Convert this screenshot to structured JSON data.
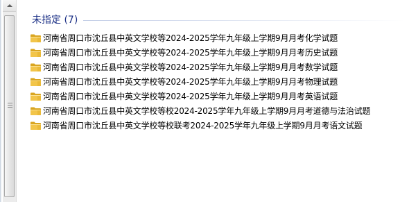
{
  "group": {
    "title": "未指定 (7)",
    "items": [
      {
        "name": "河南省周口市沈丘县中英文学校等2024-2025学年九年级上学期9月月考化学试题",
        "icon": "folder-icon"
      },
      {
        "name": "河南省周口市沈丘县中英文学校等2024-2025学年九年级上学期9月月考历史试题",
        "icon": "folder-icon"
      },
      {
        "name": "河南省周口市沈丘县中英文学校等2024-2025学年九年级上学期9月月考数学试题",
        "icon": "folder-icon"
      },
      {
        "name": "河南省周口市沈丘县中英文学校等2024-2025学年九年级上学期9月月考物理试题",
        "icon": "folder-icon"
      },
      {
        "name": "河南省周口市沈丘县中英文学校等2024-2025学年九年级上学期9月月考英语试题",
        "icon": "folder-icon"
      },
      {
        "name": "河南省周口市沈丘县中英文学校等校2024-2025学年九年级上学期9月月考道德与法治试题",
        "icon": "folder-icon"
      },
      {
        "name": "河南省周口市沈丘县中英文学校等校联考2024-2025学年九年级上学期9月月考语文试题",
        "icon": "folder-icon"
      }
    ]
  },
  "colors": {
    "group_title": "#1e3287",
    "folder_body": "#f2c54a",
    "folder_shade": "#d9a520"
  }
}
